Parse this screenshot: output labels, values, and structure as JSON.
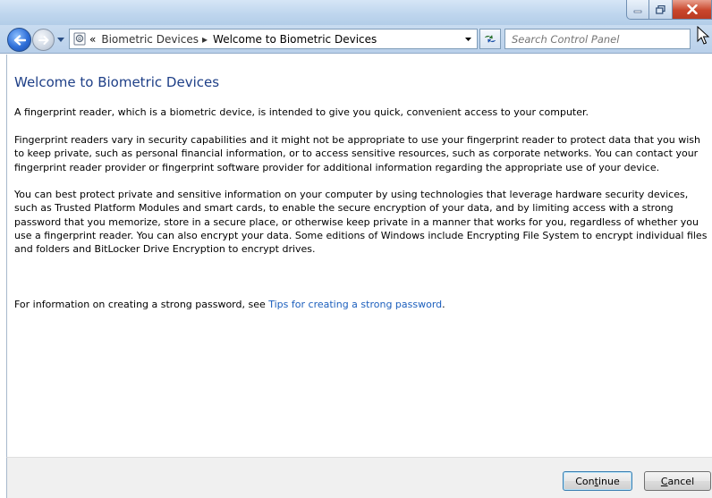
{
  "window": {
    "controls": {
      "minimize": "minimize",
      "maximize": "maximize",
      "close": "close"
    }
  },
  "nav": {
    "breadcrumb": {
      "overflow": "«",
      "items": [
        "Biometric Devices",
        "Welcome to Biometric Devices"
      ]
    },
    "search": {
      "placeholder": "Search Control Panel"
    }
  },
  "content": {
    "heading": "Welcome to Biometric Devices",
    "paragraphs": [
      "A fingerprint reader, which is a biometric device, is intended to give you quick, convenient access to your computer.",
      "Fingerprint readers vary in security capabilities and it might not be appropriate to use your fingerprint reader to protect data that you wish to keep private, such as personal financial information, or to access sensitive resources, such as corporate networks. You can contact your fingerprint reader provider or fingerprint software provider for additional information regarding the appropriate use of your device.",
      "You can best protect private and sensitive information on your computer by using technologies that leverage hardware security devices, such as Trusted Platform Modules and smart cards, to enable the secure encryption of your data, and by limiting access with a strong password that you memorize, store in a secure place, or otherwise keep private in a manner that works for you, regardless of whether you use a fingerprint reader. You can also encrypt your data. Some editions of Windows include Encrypting File System to encrypt individual files and folders and BitLocker Drive Encryption to encrypt drives."
    ],
    "password_info": {
      "prefix": "For information on creating a strong password, see ",
      "link": "Tips for creating a strong password",
      "suffix": "."
    }
  },
  "buttons": {
    "continue": {
      "before": "Con",
      "accel": "t",
      "after": "inue"
    },
    "cancel": {
      "before": "",
      "accel": "C",
      "after": "ancel"
    }
  },
  "colors": {
    "heading": "#1e3f87",
    "link": "#1c5fbd",
    "titlebar": "#bfd6ee",
    "close_button": "#c9462c"
  }
}
